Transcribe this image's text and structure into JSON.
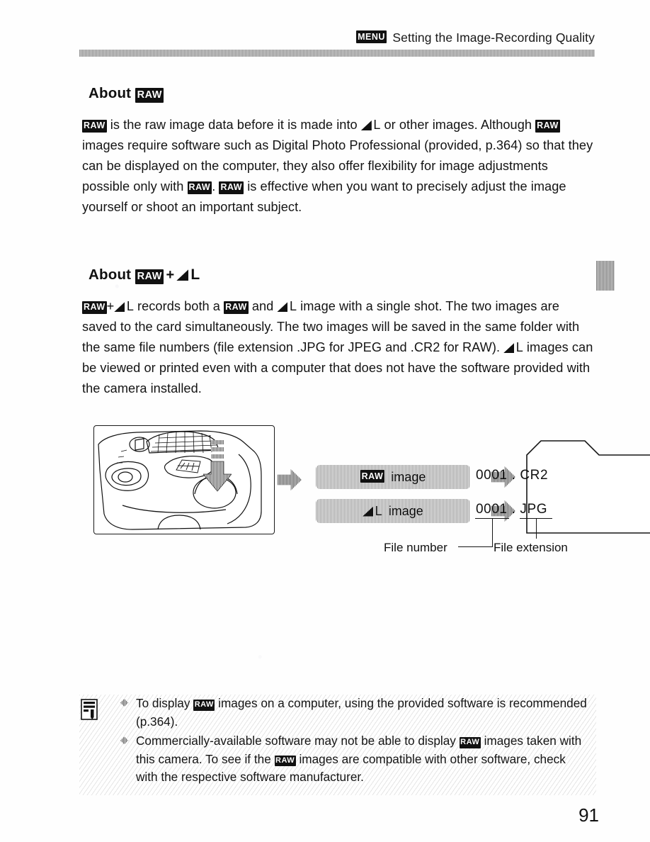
{
  "header": {
    "menu_badge": "MENU",
    "title": "Setting the Image-Recording Quality"
  },
  "sections": [
    {
      "id": "about-raw",
      "heading_prefix": "About",
      "heading_badge": "RAW",
      "paragraph_parts": [
        {
          "type": "badge",
          "text": "RAW"
        },
        {
          "type": "text",
          "text": " is the raw image data before it is made into "
        },
        {
          "type": "quality",
          "text": "L"
        },
        {
          "type": "text",
          "text": " or other images. Although "
        },
        {
          "type": "badge",
          "text": "RAW"
        },
        {
          "type": "text",
          "text": " images require software such as Digital Photo Professional (provided, p.364) so that they can be displayed on the computer, they also offer flexibility for image adjustments possible only with "
        },
        {
          "type": "badge",
          "text": "RAW"
        },
        {
          "type": "text",
          "text": ". "
        },
        {
          "type": "badge",
          "text": "RAW"
        },
        {
          "type": "text",
          "text": " is effective when you want to precisely adjust the image yourself or shoot an important subject."
        }
      ]
    },
    {
      "id": "about-raw-plus-l",
      "heading_prefix": "About",
      "heading_badge": "RAW",
      "heading_plus": "+",
      "heading_quality": "L",
      "paragraph_parts": [
        {
          "type": "badge",
          "text": "RAW"
        },
        {
          "type": "text",
          "text": "+"
        },
        {
          "type": "quality",
          "text": "L"
        },
        {
          "type": "text",
          "text": " records both a "
        },
        {
          "type": "badge",
          "text": "RAW"
        },
        {
          "type": "text",
          "text": " and "
        },
        {
          "type": "quality",
          "text": "L"
        },
        {
          "type": "text",
          "text": " image with a single shot. The two images are saved to the card simultaneously. The two images will be saved in the same folder with the same file numbers (file extension .JPG for JPEG and .CR2 for RAW). "
        },
        {
          "type": "quality",
          "text": "L"
        },
        {
          "type": "text",
          "text": " images can be viewed or printed even with a computer that does not have the software provided with the camera installed."
        }
      ]
    }
  ],
  "diagram": {
    "camera_alt": "camera top view with shutter button pressed",
    "chips": [
      {
        "badge": "RAW",
        "label": "image"
      },
      {
        "quality": "L",
        "label": "image"
      }
    ],
    "folder": {
      "files": [
        {
          "number": "0001",
          "separator": ".",
          "extension": "CR2"
        },
        {
          "number": "0001",
          "separator": ".",
          "extension": "JPG"
        }
      ]
    },
    "callouts": {
      "file_number": "File number",
      "file_extension": "File extension"
    }
  },
  "notes": [
    {
      "parts": [
        {
          "type": "text",
          "text": "To display "
        },
        {
          "type": "badge",
          "text": "RAW"
        },
        {
          "type": "text",
          "text": " images on a computer, using the provided software is recommended (p.364)."
        }
      ]
    },
    {
      "parts": [
        {
          "type": "text",
          "text": "Commercially-available software may not be able to display "
        },
        {
          "type": "badge",
          "text": "RAW"
        },
        {
          "type": "text",
          "text": " images taken with this camera. To see if the "
        },
        {
          "type": "badge",
          "text": "RAW"
        },
        {
          "type": "text",
          "text": " images are compatible with other software, check with the respective software manufacturer."
        }
      ]
    }
  ],
  "page_number": "91",
  "colors": {
    "ink": "#111111",
    "rule_gray": "#b3b3b3",
    "chip_gray": "#c6c6c6",
    "arrow_gray": "#9a9a9a"
  }
}
